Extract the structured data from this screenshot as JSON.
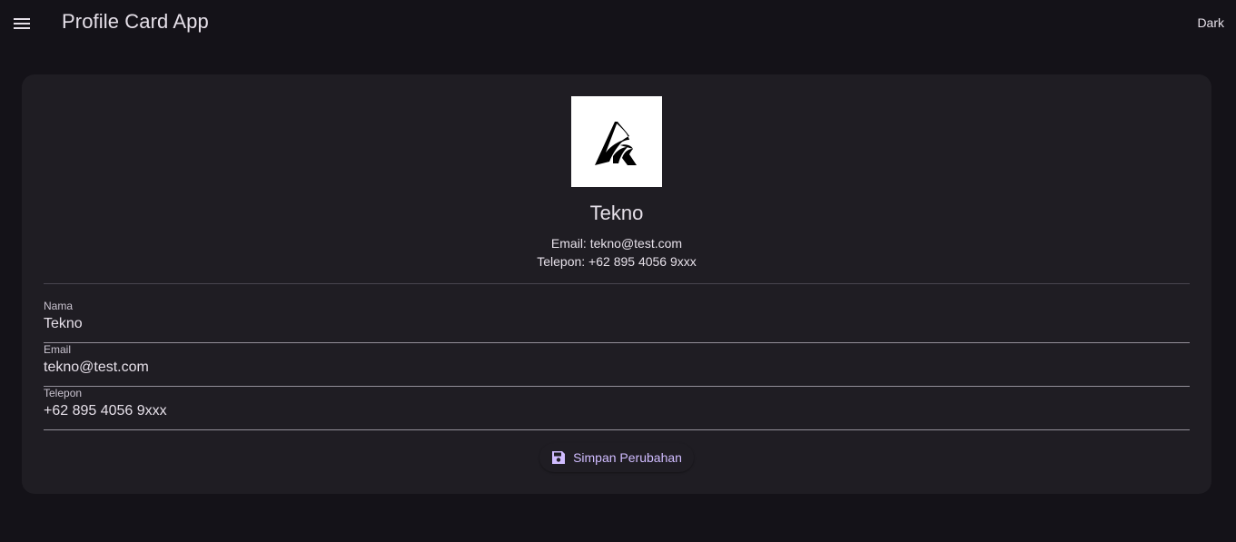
{
  "appbar": {
    "title": "Profile Card App",
    "menu_icon": "menu-icon",
    "theme_label": "Dark"
  },
  "profile": {
    "logo_icon": "logo-a-icon",
    "name": "Tekno",
    "email_line": "Email: tekno@test.com",
    "phone_line": "Telepon: +62 895 4056 9xxx"
  },
  "form": {
    "fields": [
      {
        "label": "Nama",
        "value": "Tekno"
      },
      {
        "label": "Email",
        "value": "tekno@test.com"
      },
      {
        "label": "Telepon",
        "value": "+62 895 4056 9xxx"
      }
    ],
    "save_button": {
      "label": "Simpan Perubahan",
      "icon": "save-icon"
    }
  },
  "colors": {
    "background": "#141218",
    "card": "#1f1d23",
    "accent": "#d0bcff",
    "text": "#e6e0e9"
  }
}
